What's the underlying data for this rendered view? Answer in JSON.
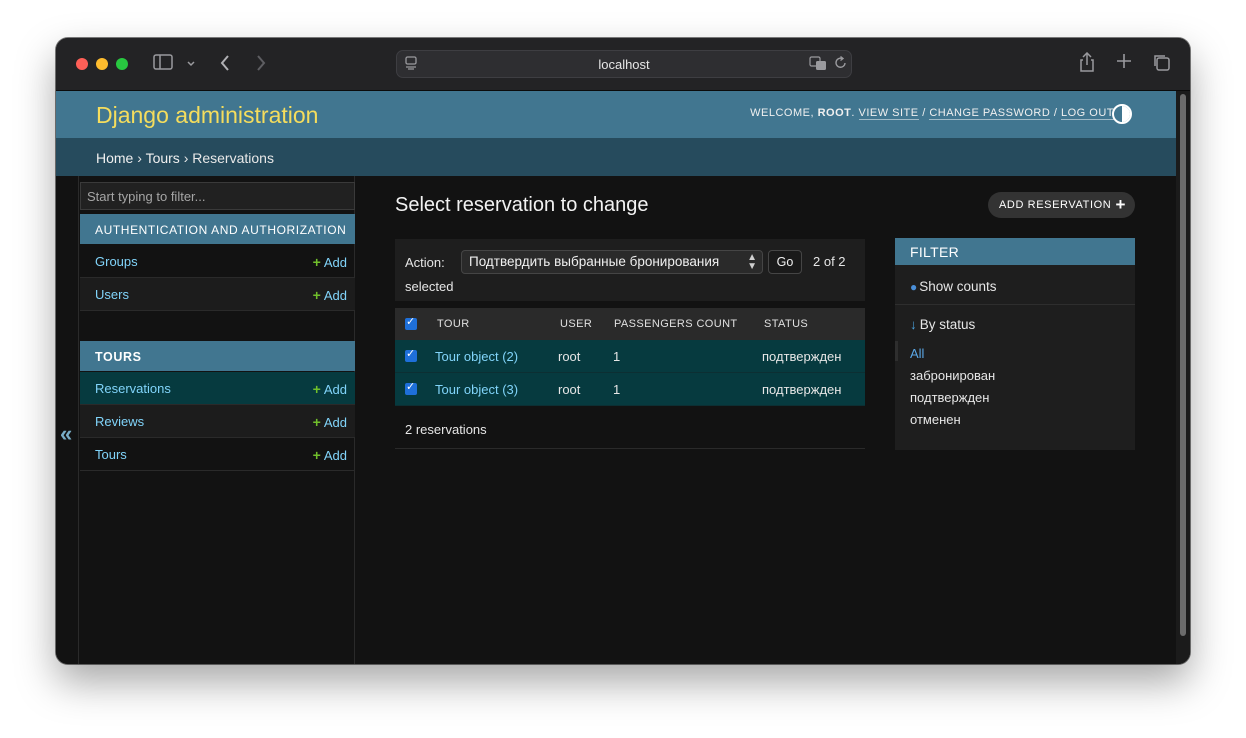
{
  "browser": {
    "url": "localhost",
    "icons": [
      "sidebar-toggle-icon",
      "chevron-down-icon",
      "back-icon",
      "forward-icon",
      "page-icon",
      "translate-icon",
      "reload-icon",
      "share-icon",
      "new-tab-icon",
      "tabs-overview-icon"
    ]
  },
  "header": {
    "brand": "Django administration",
    "welcome": "WELCOME,",
    "username": "ROOT",
    "view_site": "VIEW SITE",
    "change_password": "CHANGE PASSWORD",
    "log_out": "LOG OUT",
    "sep": "/"
  },
  "breadcrumbs": {
    "home": "Home",
    "tours": "Tours",
    "current": "Reservations",
    "sep": "›"
  },
  "sidebar": {
    "filter_placeholder": "Start typing to filter...",
    "collapse_label": "«",
    "modules": [
      {
        "caption": "AUTHENTICATION AND AUTHORIZATION",
        "models": [
          {
            "name": "Groups",
            "add": "Add"
          },
          {
            "name": "Users",
            "add": "Add"
          }
        ]
      },
      {
        "caption": "TOURS",
        "models": [
          {
            "name": "Reservations",
            "add": "Add"
          },
          {
            "name": "Reviews",
            "add": "Add"
          },
          {
            "name": "Tours",
            "add": "Add"
          }
        ]
      }
    ]
  },
  "main": {
    "title": "Select reservation to change",
    "add_button": "ADD RESERVATION",
    "actions": {
      "label": "Action:",
      "selected_action": "Подтвердить выбранные бронирования",
      "go": "Go",
      "counter": "2 of 2",
      "counter_suffix": "selected"
    },
    "columns": [
      "TOUR",
      "USER",
      "PASSENGERS COUNT",
      "STATUS"
    ],
    "rows": [
      {
        "tour": "Tour object (2)",
        "user": "root",
        "passengers": "1",
        "status": "подтвержден"
      },
      {
        "tour": "Tour object (3)",
        "user": "root",
        "passengers": "1",
        "status": "подтвержден"
      }
    ],
    "paginator": "2 reservations"
  },
  "filter": {
    "title": "FILTER",
    "show_counts": "Show counts",
    "by_status": "By status",
    "choices": [
      "All",
      "забронирован",
      "подтвержден",
      "отменен"
    ]
  },
  "colors": {
    "header_bg": "#417690",
    "brand": "#f5dd5d",
    "breadcrumbs_bg": "#264b5d",
    "link": "#81d4fa",
    "selected_row": "#063a3f",
    "add_plus": "#70bf2b"
  }
}
